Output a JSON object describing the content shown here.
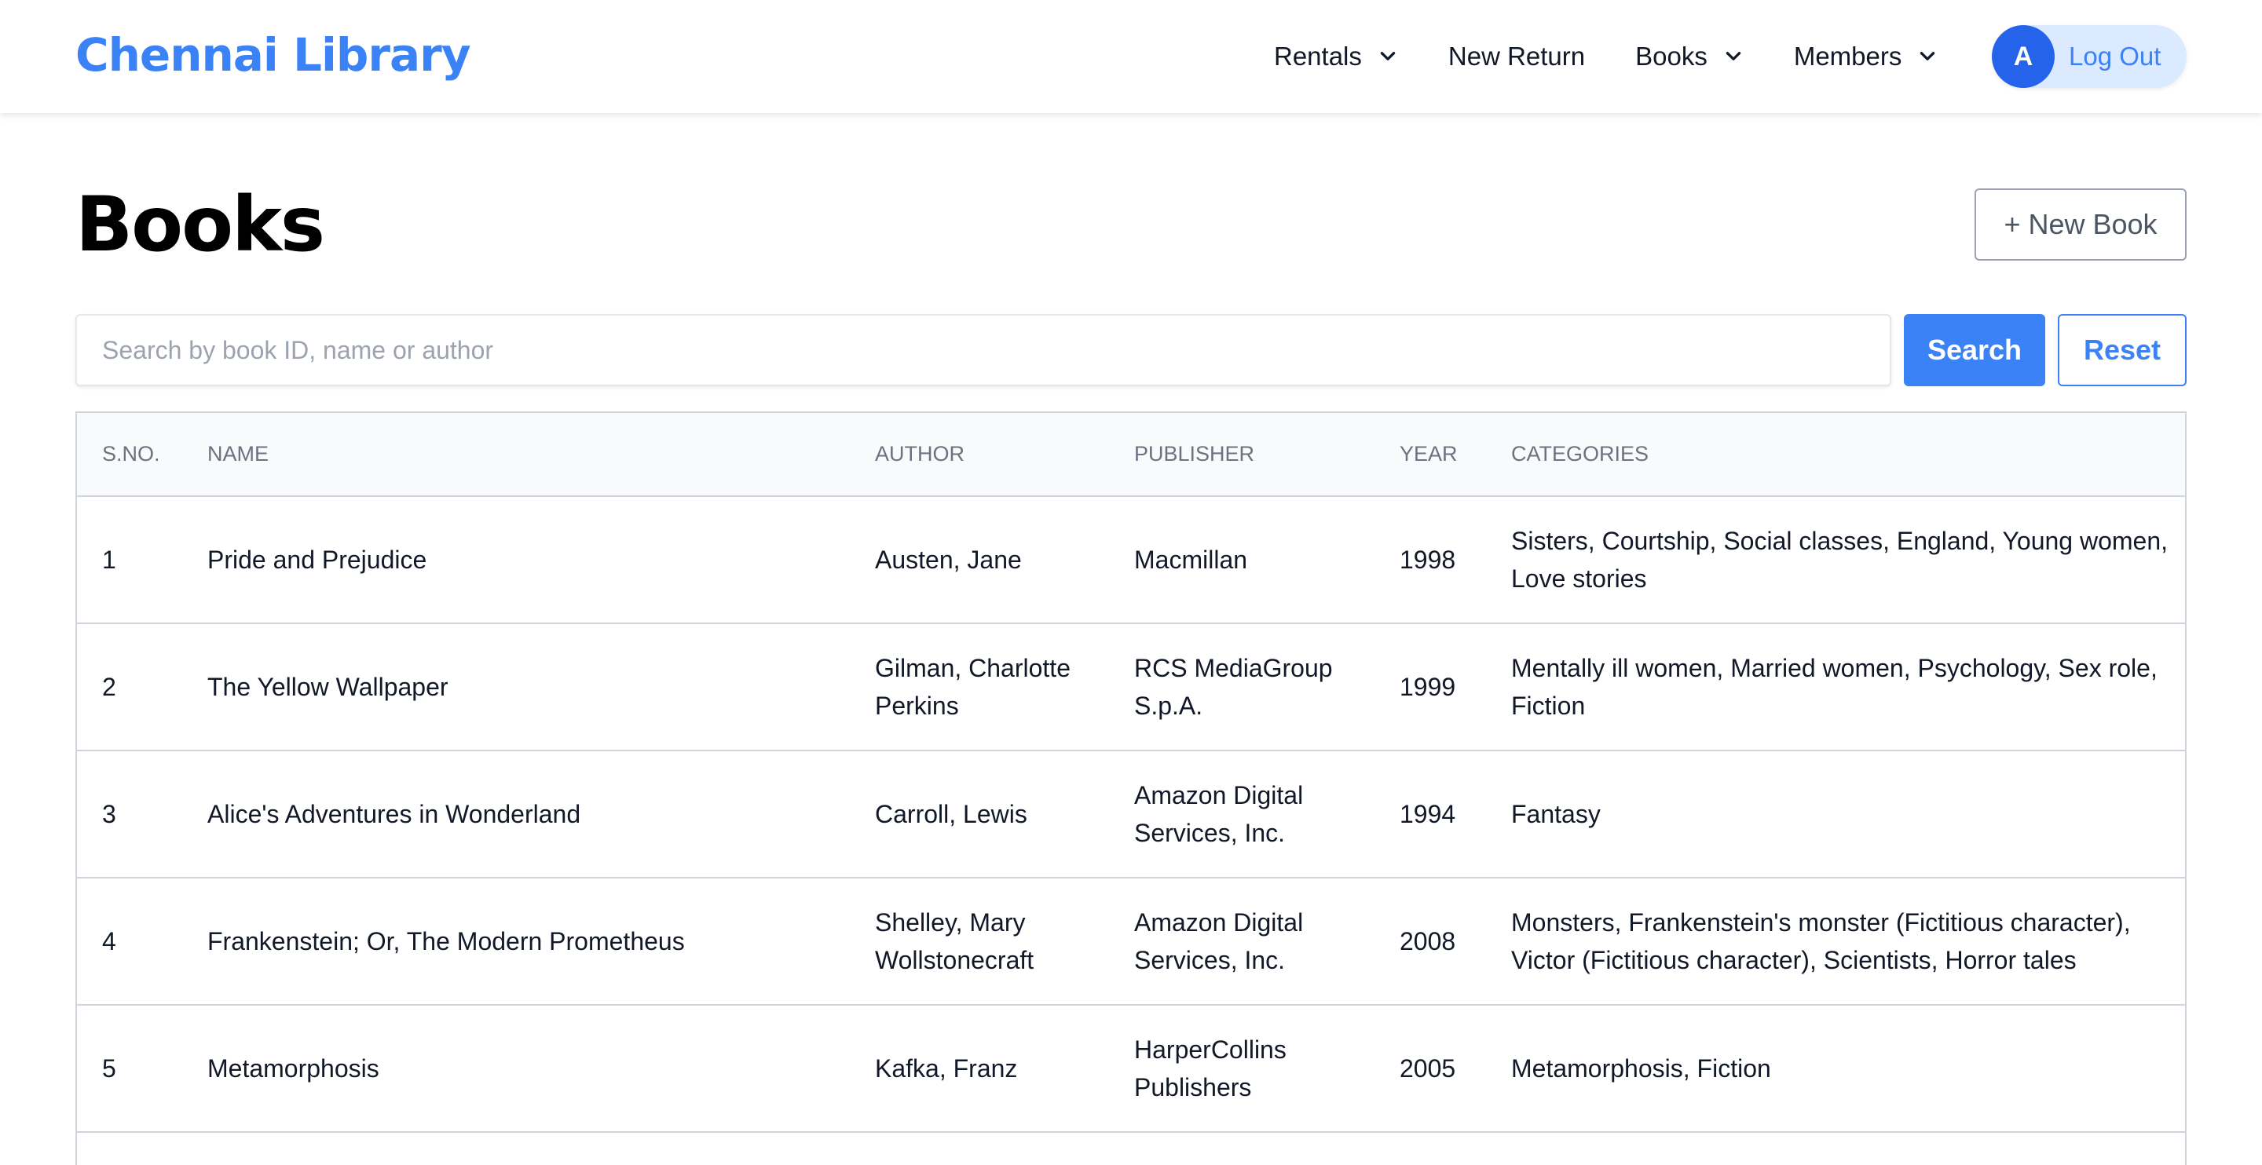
{
  "app": {
    "title": "Chennai Library"
  },
  "nav": {
    "items": [
      {
        "label": "Rentals",
        "dropdown": true
      },
      {
        "label": "New Return",
        "dropdown": false
      },
      {
        "label": "Books",
        "dropdown": true
      },
      {
        "label": "Members",
        "dropdown": true
      }
    ],
    "user": {
      "initial": "A",
      "logout_label": "Log Out"
    }
  },
  "page": {
    "title": "Books",
    "new_button": "+ New Book"
  },
  "search": {
    "placeholder": "Search by book ID, name or author",
    "value": "",
    "search_label": "Search",
    "reset_label": "Reset"
  },
  "table": {
    "headers": [
      "S.NO.",
      "NAME",
      "AUTHOR",
      "PUBLISHER",
      "YEAR",
      "CATEGORIES"
    ],
    "rows": [
      {
        "sno": "1",
        "name": "Pride and Prejudice",
        "author": "Austen, Jane",
        "publisher": "Macmillan",
        "year": "1998",
        "categories": "Sisters, Courtship, Social classes, England, Young women, Love stories"
      },
      {
        "sno": "2",
        "name": "The Yellow Wallpaper",
        "author": "Gilman, Charlotte Perkins",
        "publisher": "RCS MediaGroup S.p.A.",
        "year": "1999",
        "categories": "Mentally ill women, Married women, Psychology, Sex role, Fiction"
      },
      {
        "sno": "3",
        "name": "Alice's Adventures in Wonderland",
        "author": "Carroll, Lewis",
        "publisher": "Amazon Digital Services, Inc.",
        "year": "1994",
        "categories": "Fantasy"
      },
      {
        "sno": "4",
        "name": "Frankenstein; Or, The Modern Prometheus",
        "author": "Shelley, Mary Wollstonecraft",
        "publisher": "Amazon Digital Services, Inc.",
        "year": "2008",
        "categories": "Monsters, Frankenstein's monster (Fictitious character), Victor (Fictitious character), Scientists, Horror tales"
      },
      {
        "sno": "5",
        "name": "Metamorphosis",
        "author": "Kafka, Franz",
        "publisher": "HarperCollins Publishers",
        "year": "2005",
        "categories": "Metamorphosis, Fiction"
      }
    ]
  },
  "colors": {
    "accent": "#3b82f6",
    "avatar": "#2563eb",
    "pill": "#dbeafe"
  },
  "icons": {
    "dropdown": "chevron-down-icon"
  }
}
